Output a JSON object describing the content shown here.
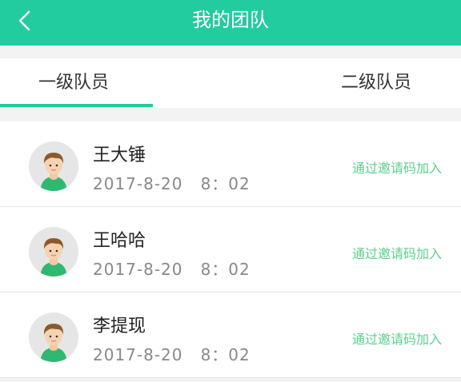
{
  "header": {
    "title": "我的团队",
    "back_icon": "back-arrow-icon",
    "background": "#22cc9e"
  },
  "tabs": [
    {
      "label": "一级队员",
      "active": true
    },
    {
      "label": "二级队员",
      "active": false
    }
  ],
  "members": [
    {
      "name": "王大锤",
      "date": "2017-8-20   8：02",
      "method": "通过邀请码加入",
      "avatar_icon": "male-avatar-icon"
    },
    {
      "name": "王哈哈",
      "date": "2017-8-20   8：02",
      "method": "通过邀请码加入",
      "avatar_icon": "male-avatar-icon"
    },
    {
      "name": "李提现",
      "date": "2017-8-20   8：02",
      "method": "通过邀请码加入",
      "avatar_icon": "male-avatar-icon"
    }
  ]
}
